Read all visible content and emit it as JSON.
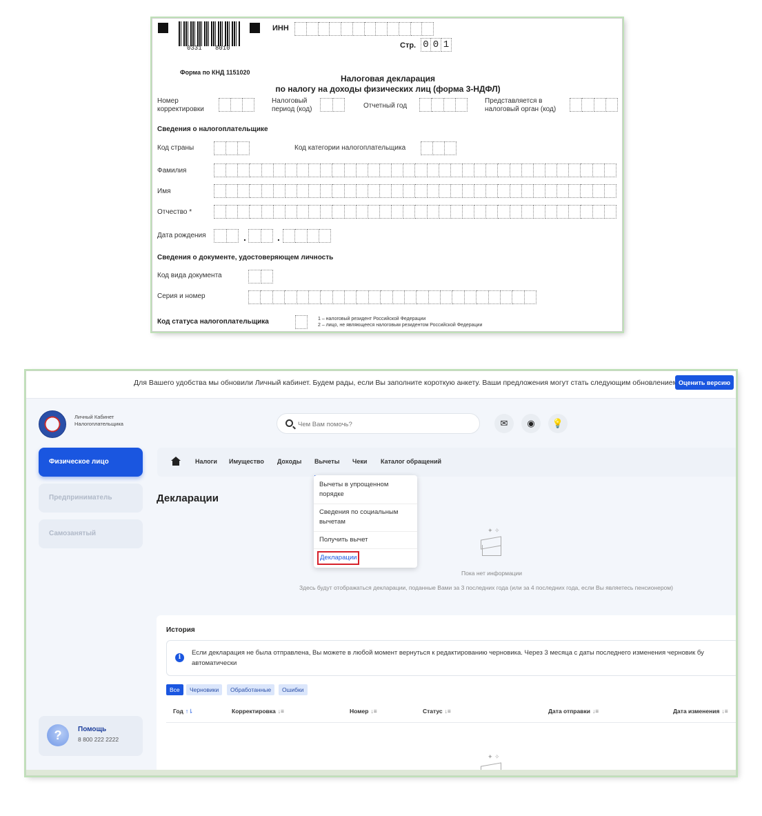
{
  "form": {
    "inn_label": "ИНН",
    "barcode_left": "0331",
    "barcode_right": "8010",
    "page_label": "Стр.",
    "page_digits": [
      "0",
      "0",
      "1"
    ],
    "knd": "Форма по КНД 1151020",
    "title_line1": "Налоговая декларация",
    "title_line2": "по налогу на доходы физических лиц (форма 3-НДФЛ)",
    "correction_label": "Номер корректировки",
    "period_label": "Налоговый период (код)",
    "year_label": "Отчетный год",
    "authority_label": "Представляется в налоговый орган (код)",
    "taxpayer_section": "Сведения о налогоплательщике",
    "country_label": "Код страны",
    "category_label": "Код категории налогоплательщика",
    "surname_label": "Фамилия",
    "name_label": "Имя",
    "patronymic_label": "Отчество *",
    "birth_label": "Дата рождения",
    "document_section": "Сведения о документе, удостоверяющем личность",
    "doc_type_label": "Код вида документа",
    "doc_number_label": "Серия и номер",
    "status_label": "Код статуса налогоплательщика",
    "status_note1": "1 – налоговый резидент Российской Федерации",
    "status_note2": "2 – лицо, не являющееся налоговым резидентом Российской Федерации"
  },
  "banner": {
    "text": "Для Вашего удобства мы обновили Личный кабинет. Будем рады, если Вы заполните короткую анкету. Ваши предложения могут стать следующим обновлением",
    "button": "Оценить версию"
  },
  "header": {
    "logo_text": "Личный Кабинет Налогоплательщика",
    "search_placeholder": "Чем Вам помочь?"
  },
  "sidebar": {
    "items": [
      {
        "label": "Физическое лицо",
        "active": true
      },
      {
        "label": "Предприниматель",
        "active": false
      },
      {
        "label": "Самозанятый",
        "active": false
      }
    ],
    "help_title": "Помощь",
    "help_phone": "8 800 222 2222"
  },
  "nav": {
    "items": [
      "Налоги",
      "Имущество",
      "Доходы",
      "Вычеты",
      "Чеки",
      "Каталог обращений"
    ]
  },
  "dropdown": {
    "items": [
      "Вычеты в упрощенном порядке",
      "Сведения по социальным вычетам",
      "Получить вычет",
      "Декларации"
    ]
  },
  "main": {
    "title": "Декларации",
    "empty_title": "Пока нет информации",
    "empty_sub": "Здесь будут отображаться декларации, поданные Вами за 3 последних года (или за 4 последних года, если Вы являетесь пенсионером)"
  },
  "history": {
    "title": "История",
    "info": "Если декларация не была отправлена, Вы можете в любой момент вернуться к редактированию черновика. Через 3 месяца с даты последнего изменения черновик бу автоматически",
    "filters": [
      "Все",
      "Черновики",
      "Обработанные",
      "Ошибки"
    ],
    "columns": [
      "Год",
      "Корректировка",
      "Номер",
      "Статус",
      "Дата отправки",
      "Дата изменения"
    ]
  },
  "colors": {
    "accent": "#1a56e0",
    "highlight": "#d6202a"
  }
}
